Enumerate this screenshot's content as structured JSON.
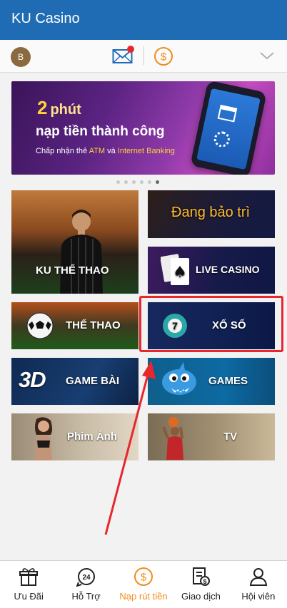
{
  "app": {
    "title": "KU Casino"
  },
  "user": {
    "avatar_letter": "B"
  },
  "banner": {
    "headline_num": "2",
    "headline_word": "phút",
    "line2": "nạp tiền thành công",
    "line3_prefix": "Chấp nhận thẻ",
    "line3_atm": "ATM",
    "line3_mid": "và",
    "line3_ib": "Internet Banking",
    "dots_total": 6,
    "dots_active_index": 5
  },
  "tiles": {
    "ku_sport": "KU THỂ THAO",
    "maintenance": "Đang bảo trì",
    "live_casino": "LIVE CASINO",
    "sports": "THỂ THAO",
    "lottery": "XỔ SỐ",
    "card_games": "GAME BÀI",
    "card_games_badge": "3D",
    "games": "GAMES",
    "movies": "Phim Ảnh",
    "tv": "TV"
  },
  "nav": [
    {
      "label": "Ưu Đãi",
      "icon": "gift-icon"
    },
    {
      "label": "Hỗ Trợ",
      "icon": "support-24-icon"
    },
    {
      "label": "Nạp rút tiền",
      "icon": "deposit-coin-icon",
      "active": true
    },
    {
      "label": "Giao dịch",
      "icon": "transaction-icon"
    },
    {
      "label": "Hội viên",
      "icon": "member-icon"
    }
  ],
  "colors": {
    "header": "#1f6cb5",
    "accent_orange": "#f08c1a",
    "annotation_red": "#e8262d"
  }
}
